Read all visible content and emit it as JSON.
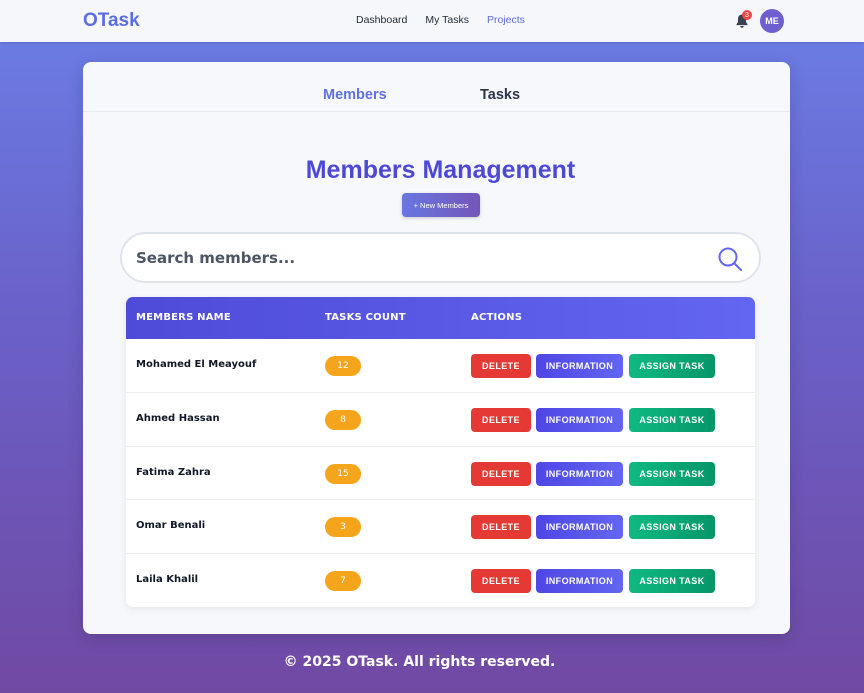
{
  "colors": {
    "brand": "#5a6ee0",
    "title": "#4d49d6",
    "delete": "#e53935",
    "information": "#4f46e5",
    "assign": "#10b981",
    "count_badge": "#f5a51b"
  },
  "nav": {
    "brand": "OTask",
    "links": [
      "Dashboard",
      "My Tasks",
      "Projects"
    ],
    "active_link": "Projects",
    "notification_count": "3",
    "avatar_initials": "ME",
    "bell_icon": "bell-icon"
  },
  "tabs": [
    "Members",
    "Tasks"
  ],
  "page": {
    "title": "Members Management",
    "new_button": "+ New Members",
    "search_placeholder": "Search members...",
    "search_icon": "search-icon"
  },
  "table": {
    "headers": [
      "MEMBERS NAME",
      "TASKS COUNT",
      "ACTIONS"
    ],
    "rows": [
      {
        "name": "Mohamed El Meayouf",
        "count": "12"
      },
      {
        "name": "Ahmed Hassan",
        "count": "8"
      },
      {
        "name": "Fatima Zahra",
        "count": "15"
      },
      {
        "name": "Omar Benali",
        "count": "3"
      },
      {
        "name": "Laila Khalil",
        "count": "7"
      }
    ],
    "actions": {
      "delete": "DELETE",
      "information": "INFORMATION",
      "assign": "ASSIGN TASK"
    }
  },
  "footer": "© 2025 OTask. All rights reserved."
}
